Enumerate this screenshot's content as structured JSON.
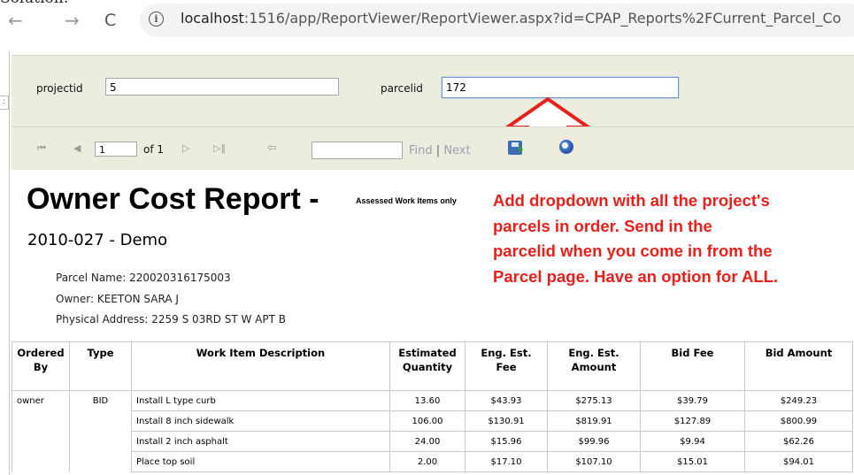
{
  "page_fragment": "Solution:",
  "browser": {
    "back": "←",
    "forward": "→",
    "reload": "C",
    "info": "i",
    "url_host": "localhost",
    "url_rest": ":1516/app/ReportViewer/ReportViewer.aspx?id=CPAP_Reports%2FCurrent_Parcel_Co"
  },
  "params": {
    "projectid_label": "projectid",
    "projectid_value": "5",
    "parcelid_label": "parcelid",
    "parcelid_value": "172"
  },
  "toolbar": {
    "first": "⏮",
    "prev": "◀",
    "page_value": "1",
    "of_pages": "of 1",
    "next": "▷",
    "last": "▷‖",
    "back": "⇦",
    "find": "Find",
    "separator": "|",
    "next_link": "Next"
  },
  "report": {
    "title": "Owner Cost Report -",
    "subtitle": "Assessed Work Items only",
    "project": "2010-027 -  Demo",
    "parcel_name": "Parcel Name: 220020316175003",
    "owner": "Owner: KEETON SARA J",
    "address": "Physical Address: 2259 S 03RD ST W APT B"
  },
  "annotation": {
    "lines": [
      "Add dropdown with all the project's",
      "parcels in order. Send in the",
      "parcelid when you come in from the",
      "Parcel page. Have an option for ALL."
    ],
    "color": "#e8201c"
  },
  "table": {
    "headers": [
      "Ordered By",
      "Type",
      "Work Item Description",
      "Estimated Quantity",
      "Eng. Est. Fee",
      "Eng. Est. Amount",
      "Bid Fee",
      "Bid Amount"
    ],
    "rows": [
      [
        "owner",
        "BID",
        "Install L type curb",
        "13.60",
        "$43.93",
        "$275.13",
        "$39.79",
        "$249.23"
      ],
      [
        "",
        "",
        "Install 8 inch sidewalk",
        "106.00",
        "$130.91",
        "$819.91",
        "$127.89",
        "$800.99"
      ],
      [
        "",
        "",
        "Install 2 inch asphalt",
        "24.00",
        "$15.96",
        "$99.96",
        "$9.94",
        "$62.26"
      ],
      [
        "",
        "",
        "Place top soil",
        "2.00",
        "$17.10",
        "$107.10",
        "$15.01",
        "$94.01"
      ]
    ]
  }
}
